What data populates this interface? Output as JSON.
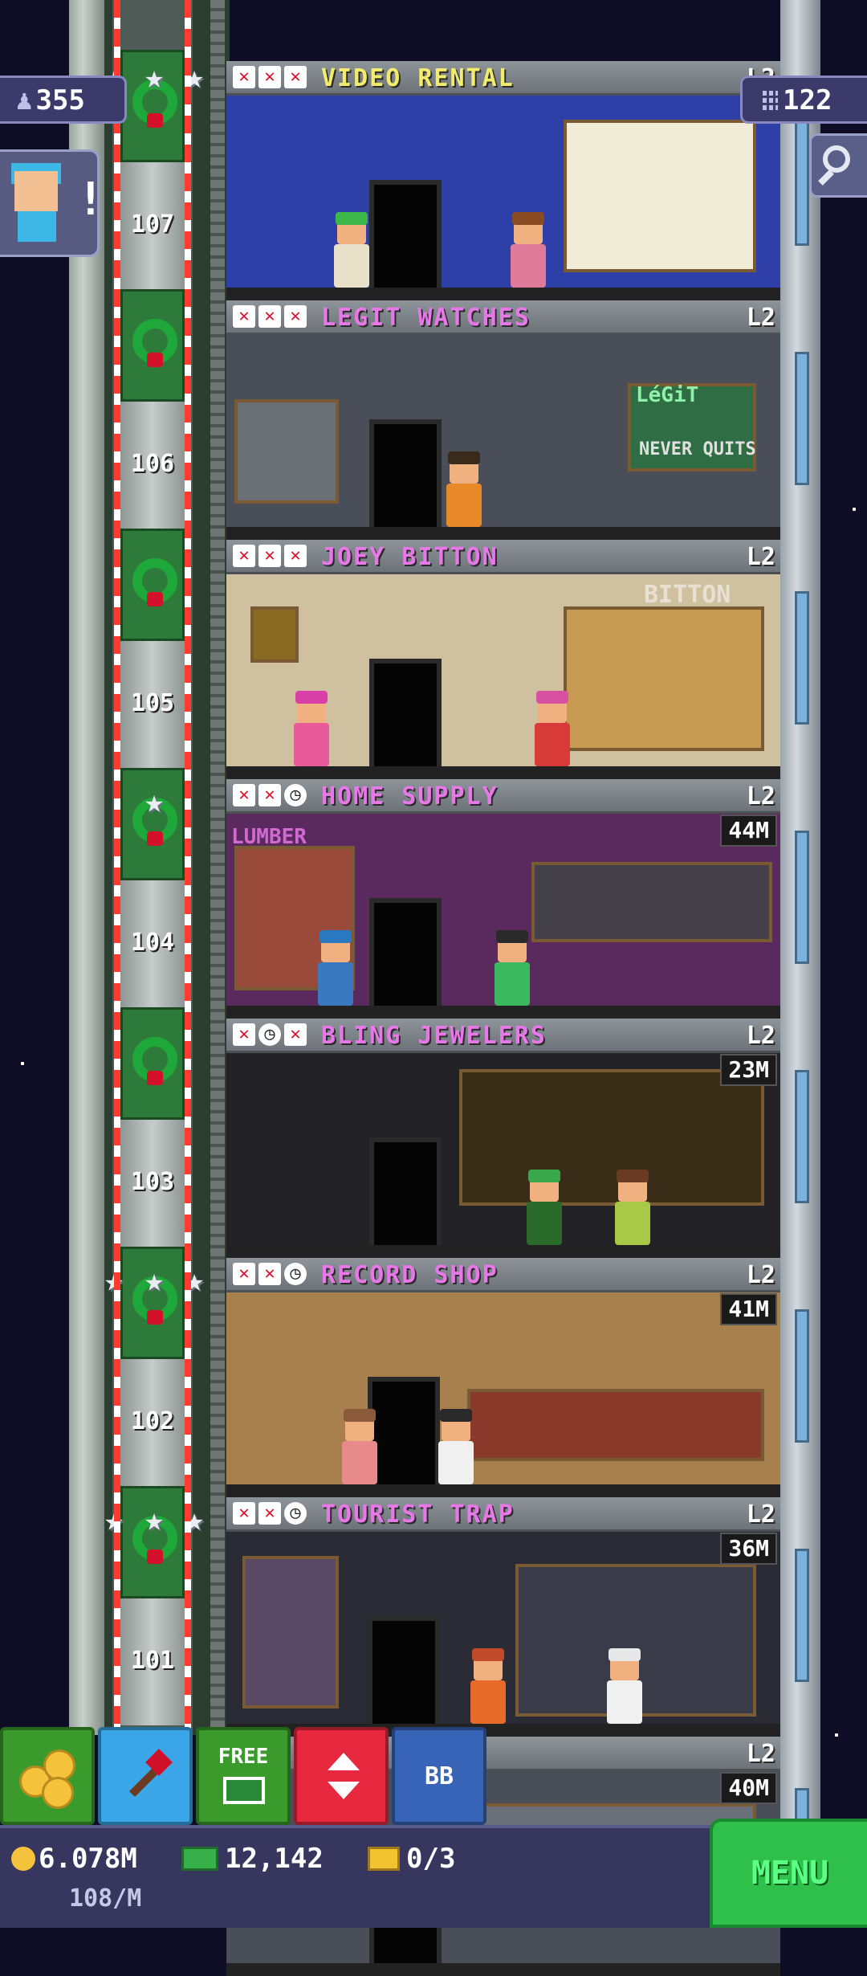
{
  "hud": {
    "population": "355",
    "floor_count": "122",
    "population_icon": "person-icon",
    "floors_icon": "building-icon"
  },
  "shaft": {
    "floor_numbers": [
      "107",
      "106",
      "105",
      "104",
      "103",
      "102",
      "101"
    ]
  },
  "floors": [
    {
      "name": "VIDEO RENTAL",
      "name_color": "#f2ec6c",
      "level": "L2",
      "stock": "",
      "stars": [
        "x",
        "x",
        "x"
      ],
      "wall": "#2f3fa8"
    },
    {
      "name": "LEGIT WATCHES",
      "name_color": "#e878e8",
      "level": "L2",
      "stock": "",
      "stars": [
        "x",
        "x",
        "x"
      ],
      "wall": "#4a4e58"
    },
    {
      "name": "JOEY BITTON",
      "name_color": "#e878e8",
      "level": "L2",
      "stock": "",
      "stars": [
        "x",
        "x",
        "x"
      ],
      "wall": "#cfc0a0"
    },
    {
      "name": "HOME SUPPLY",
      "name_color": "#e878e8",
      "level": "L2",
      "stock": "44M",
      "stars": [
        "x",
        "x",
        "clock"
      ],
      "wall": "#5a2a5e"
    },
    {
      "name": "BLING JEWELERS",
      "name_color": "#e878e8",
      "level": "L2",
      "stock": "23M",
      "stars": [
        "x",
        "clock",
        "x"
      ],
      "wall": "#232226"
    },
    {
      "name": "RECORD SHOP",
      "name_color": "#e878e8",
      "level": "L2",
      "stock": "41M",
      "stars": [
        "x",
        "x",
        "clock"
      ],
      "wall": "#a8804e"
    },
    {
      "name": "TOURIST TRAP",
      "name_color": "#e878e8",
      "level": "L2",
      "stock": "36M",
      "stars": [
        "x",
        "x",
        "clock"
      ],
      "wall": "#2a2b34"
    },
    {
      "name": "",
      "name_color": "#e878e8",
      "level": "L2",
      "stock": "40M",
      "stars": [],
      "wall": "#4a4e58"
    }
  ],
  "room_signs": {
    "legit_logo": "LéGiT",
    "legit_slogan": "NEVER QUITS",
    "bitton_sign": "BITTON",
    "lumber_sign": "LUMBER"
  },
  "toolbar": {
    "free_label": "FREE",
    "bb_label": "BB"
  },
  "status": {
    "coins": "6.078M",
    "coin_rate": "108/M",
    "bux": "12,142",
    "tickets": "0/3"
  },
  "menu": {
    "label": "MENU"
  },
  "colors": {
    "sky": "#0f0d26",
    "menu_green": "#2ec04a",
    "status_bar": "#36365e",
    "elevator_red": "#e8283e",
    "build_blue": "#3aa6e8",
    "bb_blue": "#3864b8"
  }
}
